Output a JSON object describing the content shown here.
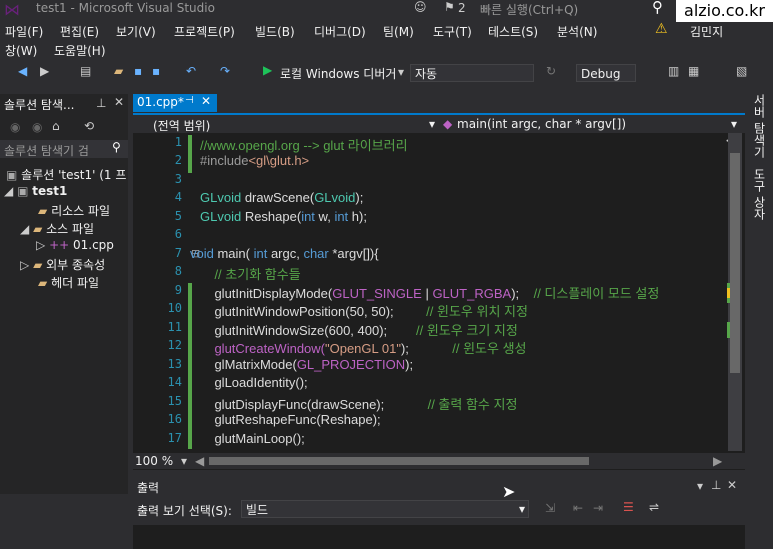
{
  "window": {
    "title": "test1 - Microsoft Visual Studio",
    "notifications": "2",
    "quick_launch": "빠른 실행(Ctrl+Q)",
    "user": "김민지",
    "watermark": "alzio.co.kr"
  },
  "menu": {
    "row1": [
      "파일(F)",
      "편집(E)",
      "보기(V)",
      "프로젝트(P)",
      "빌드(B)",
      "디버그(D)",
      "팀(M)",
      "도구(T)",
      "테스트(S)",
      "분석(N)"
    ],
    "row2": [
      "창(W)",
      "도움말(H)"
    ]
  },
  "toolbar": {
    "run_label": "로컬 Windows 디버거",
    "platform": "자동",
    "config": "Debug"
  },
  "solution_explorer": {
    "title": "솔루션 탐색...",
    "search_placeholder": "솔루션 탐색기 검",
    "items": [
      {
        "label": "솔루션 'test1' (1 프"
      },
      {
        "label": "test1"
      },
      {
        "label": "리소스 파일"
      },
      {
        "label": "소스 파일"
      },
      {
        "label": "01.cpp"
      },
      {
        "label": "외부 종속성"
      },
      {
        "label": "헤더 파일"
      }
    ]
  },
  "editor": {
    "tab": "01.cpp*",
    "scope": "(전역 범위)",
    "member": "main(int argc, char * argv[])",
    "zoom": "100 %",
    "line_numbers": [
      "1",
      "2",
      "3",
      "4",
      "5",
      "6",
      "7",
      "8",
      "9",
      "10",
      "11",
      "12",
      "13",
      "14",
      "15",
      "16",
      "17"
    ]
  },
  "code": {
    "l1": "//www.opengl.org --> glut 라이브러리",
    "l2a": "#include",
    "l2b": "<gl\\glut.h>",
    "l4a": "GLvoid",
    "l4b": " drawScene(",
    "l4c": "GLvoid",
    "l4d": ");",
    "l5a": "GLvoid",
    "l5b": " Reshape(",
    "l5c": "int",
    "l5d": " w, ",
    "l5e": "int",
    "l5f": " h);",
    "l7a": "void",
    "l7b": " main( ",
    "l7c": "int",
    "l7d": " argc, ",
    "l7e": "char",
    "l7f": " *argv[]){",
    "l8": "    // 초기화 함수들",
    "l9a": "    glutInitDisplayMode(",
    "l9b": "GLUT_SINGLE",
    "l9c": " | ",
    "l9d": "GLUT_RGBA",
    "l9e": ");    ",
    "l9f": "// 디스플레이 모드 설정",
    "l10a": "    glutInitWindowPosition(50, 50);         ",
    "l10b": "// 윈도우 위치 지정",
    "l11a": "    glutInitWindowSize(600, 400);        ",
    "l11b": "// 윈도우 크기 지정",
    "l12a": "    glutCreateWindow(",
    "l12b": "\"OpenGL 01\"",
    "l12c": ");            ",
    "l12d": "// 윈도우 생성",
    "l13a": "    glMatrixMode(",
    "l13b": "GL_PROJECTION",
    "l13c": ");",
    "l14": "    glLoadIdentity();",
    "l15a": "    glutDisplayFunc(drawScene);            ",
    "l15b": "// 출력 함수 지정",
    "l16": "    glutReshapeFunc(Reshape);",
    "l17": "    glutMainLoop();"
  },
  "output": {
    "title": "출력",
    "show_label": "출력 보기 선택(S):",
    "source": "빌드"
  },
  "right_tabs": [
    "서버 탐색기",
    "도구 상자"
  ]
}
